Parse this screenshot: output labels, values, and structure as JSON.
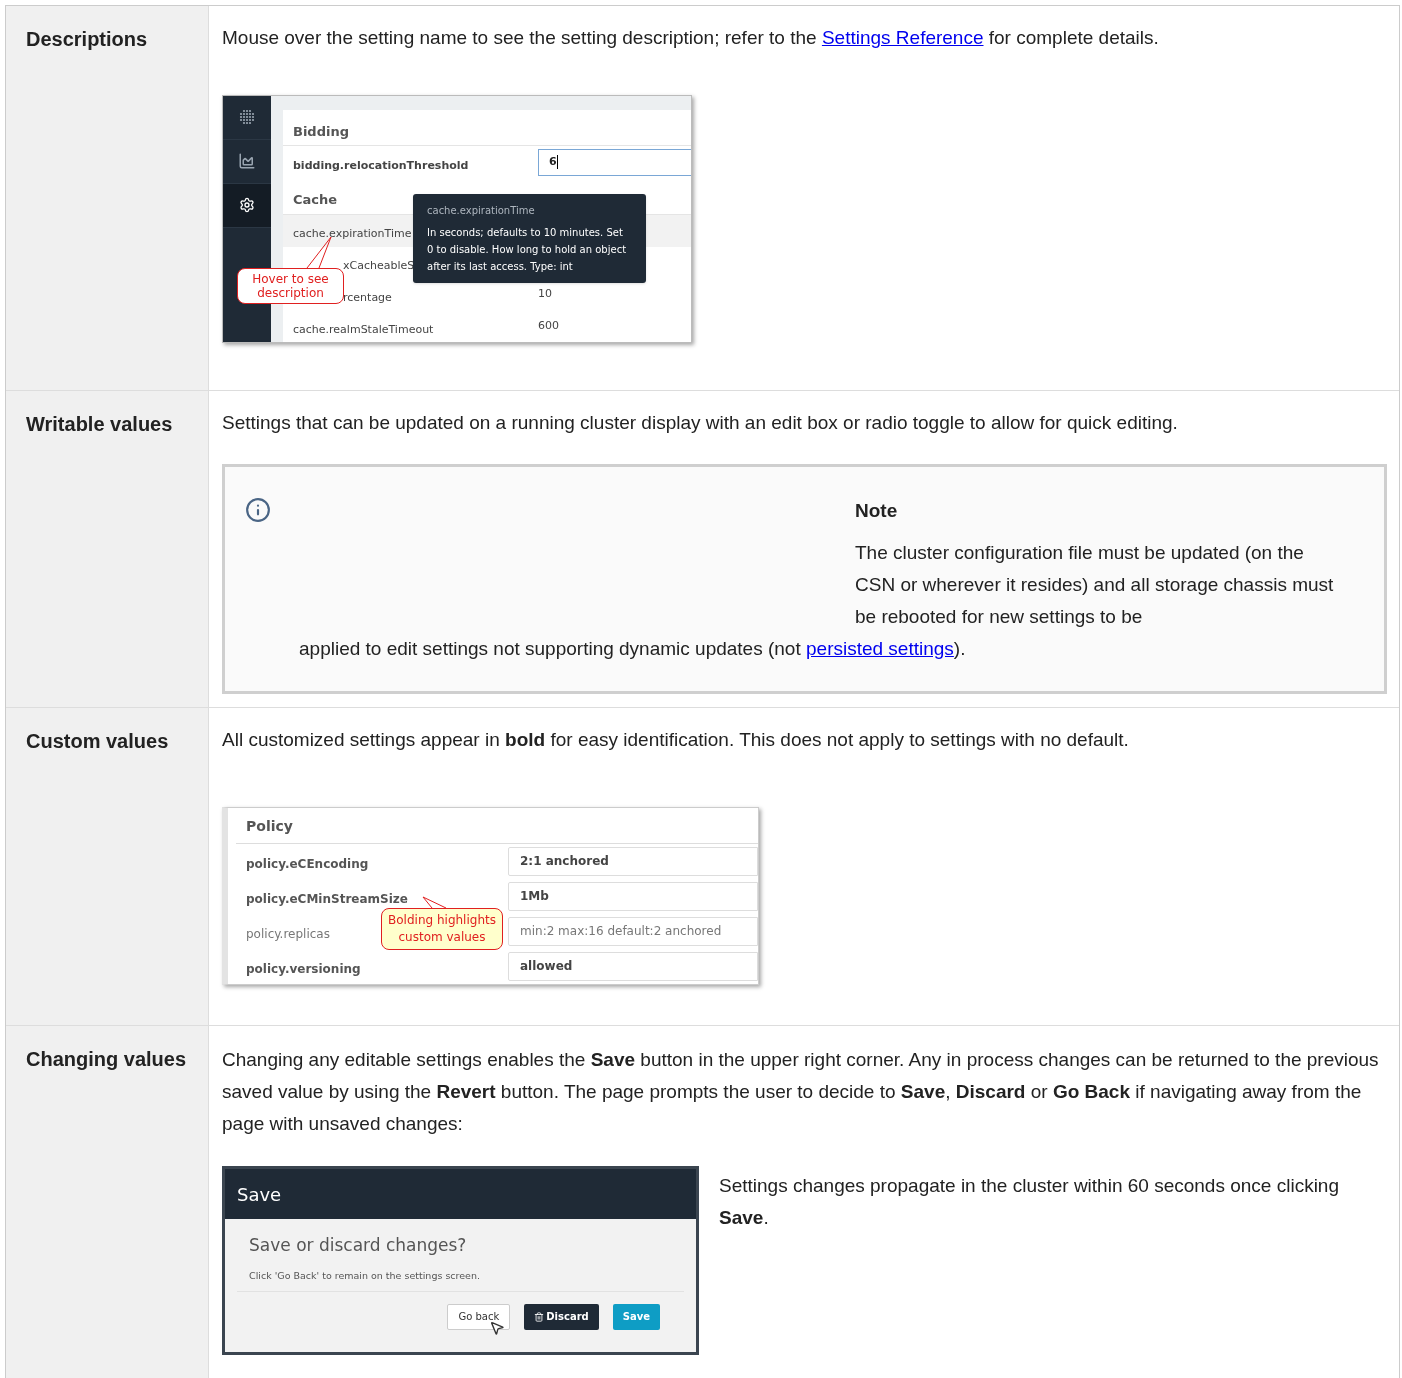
{
  "rows": [
    {
      "kind": "descriptions",
      "label": "Descriptions",
      "text_before": "Mouse over the setting name to see the setting description; refer to the ",
      "link": "Settings Reference",
      "text_after": " for complete details.",
      "screenshot": {
        "sidebar": [
          {
            "kind": "logo",
            "selected": false
          },
          {
            "kind": "chart",
            "selected": false
          },
          {
            "kind": "settings",
            "selected": true
          }
        ],
        "sections": [
          {
            "title": "Bidding",
            "rows": [
              {
                "name": "bidding.relocationThreshold",
                "value": "6",
                "kind": "input",
                "hovered": false
              }
            ]
          },
          {
            "title": "Cache",
            "rows": [
              {
                "name": "cache.expirationTime",
                "kind": "text",
                "hovered": true
              },
              {
                "name": "xCacheableS",
                "kind": "covered",
                "hovered": false
              },
              {
                "name": "rcentage",
                "value": "10",
                "kind": "covered",
                "hovered": false
              },
              {
                "name": "cache.realmStaleTimeout",
                "value": "600",
                "kind": "text",
                "hovered": false
              }
            ]
          }
        ],
        "tooltip": {
          "title": "cache.expirationTime",
          "text": "In seconds; defaults to 10 minutes. Set 0 to disable. How long to hold an object after its last access. Type: int"
        },
        "callout": "Hover to see description"
      }
    },
    {
      "kind": "writable",
      "label": "Writable values",
      "text": "Settings that can be updated on a running cluster display with an edit box or radio toggle to allow for quick editing.",
      "note": {
        "title": "Note",
        "text": "The cluster configuration file must be updated (on the CSN or wherever it resides) and all storage chassis must be rebooted for new settings to be",
        "continuation_before": "applied to edit settings not supporting dynamic updates (not ",
        "link": "persisted settings",
        "continuation_after": ")."
      }
    },
    {
      "kind": "custom",
      "label": "Custom values",
      "text": "All customized settings appear in **bold** for easy identification. This does not apply to settings with no default.",
      "screenshot": {
        "title": "Policy",
        "rows": [
          {
            "name": "policy.eCEncoding",
            "value": "2:1 anchored",
            "custom": true
          },
          {
            "name": "policy.eCMinStreamSize",
            "value": "1Mb",
            "custom": true
          },
          {
            "name": "policy.replicas",
            "value": "min:2 max:16 default:2 anchored",
            "custom": false
          },
          {
            "name": "policy.versioning",
            "value": "allowed",
            "custom": true
          }
        ],
        "callout": "Bolding highlights custom values"
      }
    },
    {
      "kind": "changing",
      "label": "Changing values",
      "text": "Changing any editable settings enables the **Save** button in the upper right corner. Any in process changes can be returned to the previous saved value by using the **Revert** button. The page prompts the user to decide to **Save**, **Discard** or **Go Back** if navigating away from the page with unsaved changes:",
      "dialog": {
        "title": "Save",
        "heading": "Save or discard changes?",
        "text": "Click 'Go Back' to remain on the settings screen.",
        "buttons": [
          {
            "label": "Go back",
            "kind": "default"
          },
          {
            "label": "Discard",
            "kind": "danger"
          },
          {
            "label": "Save",
            "kind": "primary"
          }
        ]
      },
      "side_text": "Settings changes propagate in the cluster within 60 seconds once clicking **Save**."
    }
  ]
}
